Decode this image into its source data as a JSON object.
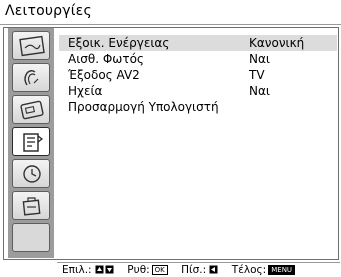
{
  "header": {
    "title": "Λειτουργίες"
  },
  "sidebar": {
    "tabs": [
      {
        "icon": "picture-icon",
        "active": false
      },
      {
        "icon": "sound-icon",
        "active": false
      },
      {
        "icon": "screen-icon",
        "active": false
      },
      {
        "icon": "features-icon",
        "active": true
      },
      {
        "icon": "timer-icon",
        "active": false
      },
      {
        "icon": "setup-icon",
        "active": false
      },
      {
        "icon": "",
        "active": false
      }
    ]
  },
  "menu": {
    "items": [
      {
        "label": "Εξοικ. Ενέργειας",
        "value": "Κανονική",
        "selected": true
      },
      {
        "label": "Αισθ. Φωτός",
        "value": "Ναι",
        "selected": false
      },
      {
        "label": "Έξοδος AV2",
        "value": "TV",
        "selected": false
      },
      {
        "label": "Ηχεία",
        "value": "Ναι",
        "selected": false
      },
      {
        "label": "Προσαρμογή Υπολογιστή",
        "value": "",
        "selected": false
      }
    ]
  },
  "footer": {
    "select_label": "Επιλ.:",
    "adjust_label": "Ρυθ:",
    "adjust_key": "OK",
    "back_label": "Πίσ.:",
    "end_label": "Τέλος:",
    "end_key": "MENU"
  }
}
